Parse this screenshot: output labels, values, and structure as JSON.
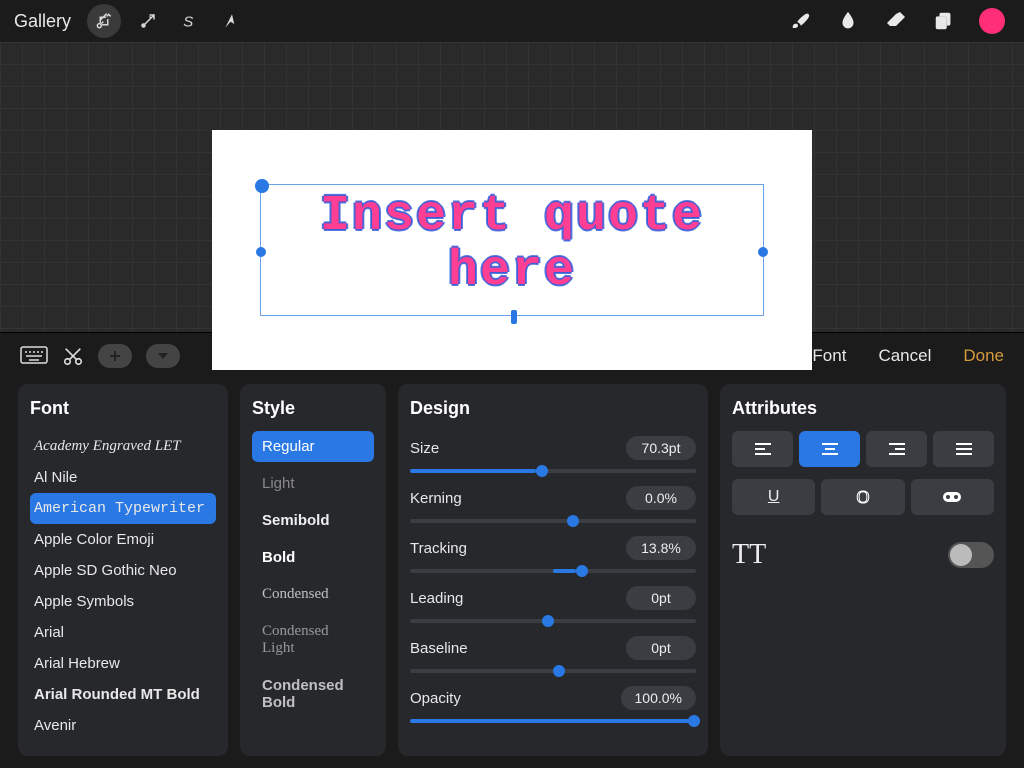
{
  "topbar": {
    "gallery": "Gallery"
  },
  "canvas": {
    "text": "Insert quote here"
  },
  "panelbar": {
    "import": "Import Font",
    "cancel": "Cancel",
    "done": "Done"
  },
  "font": {
    "title": "Font",
    "items": [
      "Academy Engraved LET",
      "Al Nile",
      "American Typewriter",
      "Apple Color Emoji",
      "Apple SD Gothic Neo",
      "Apple Symbols",
      "Arial",
      "Arial Hebrew",
      "Arial Rounded MT Bold",
      "Avenir"
    ],
    "selected": "American Typewriter"
  },
  "style": {
    "title": "Style",
    "items": [
      "Regular",
      "Light",
      "Semibold",
      "Bold",
      "Condensed",
      "Condensed Light",
      "Condensed Bold"
    ],
    "selected": "Regular"
  },
  "design": {
    "title": "Design",
    "rows": {
      "size": {
        "label": "Size",
        "value": "70.3pt",
        "pct": 44
      },
      "kerning": {
        "label": "Kerning",
        "value": "0.0%",
        "pct": 55
      },
      "tracking": {
        "label": "Tracking",
        "value": "13.8%",
        "pct": 58
      },
      "leading": {
        "label": "Leading",
        "value": "0pt",
        "pct": 46
      },
      "baseline": {
        "label": "Baseline",
        "value": "0pt",
        "pct": 50
      },
      "opacity": {
        "label": "Opacity",
        "value": "100.0%",
        "pct": 100
      }
    }
  },
  "attributes": {
    "title": "Attributes",
    "align_selected": 1,
    "tt_label": "TT",
    "caps_toggle": false
  }
}
